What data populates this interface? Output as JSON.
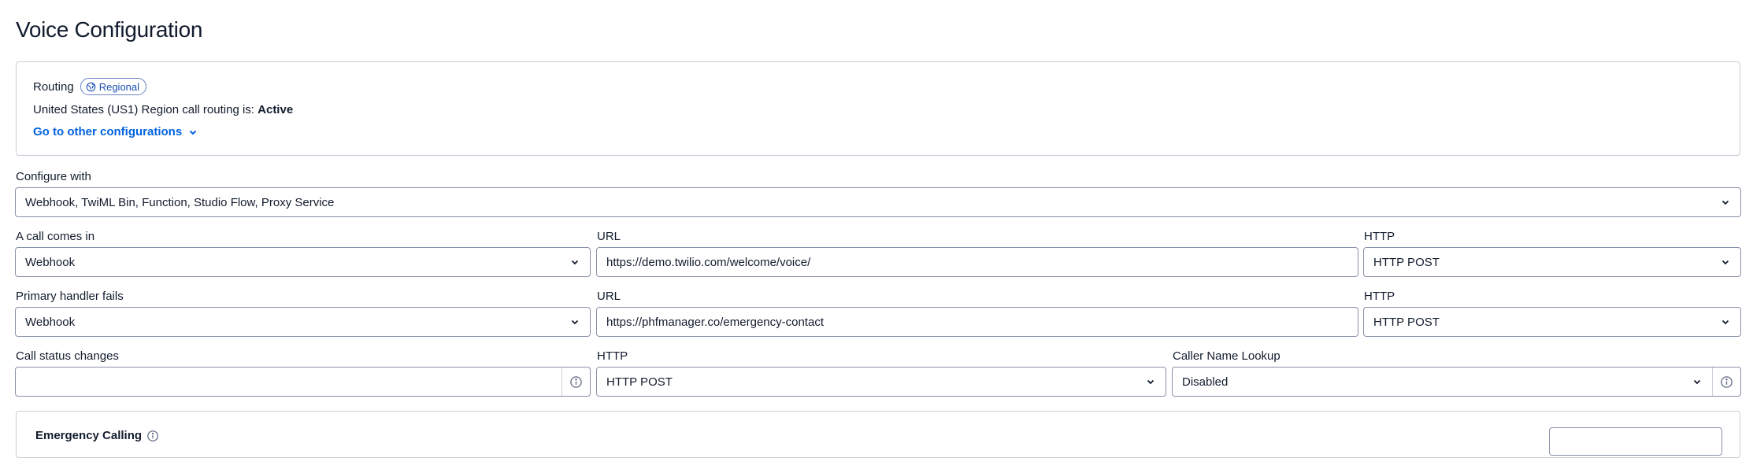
{
  "page": {
    "title": "Voice Configuration"
  },
  "routing": {
    "title": "Routing",
    "badge": "Regional",
    "status_prefix": "United States (US1) Region call routing is: ",
    "status_value": "Active",
    "link_label": "Go to other configurations"
  },
  "configure_with": {
    "label": "Configure with",
    "value": "Webhook, TwiML Bin, Function, Studio Flow, Proxy Service"
  },
  "call_comes_in": {
    "label": "A call comes in",
    "type_value": "Webhook",
    "url_label": "URL",
    "url_value": "https://demo.twilio.com/welcome/voice/",
    "http_label": "HTTP",
    "http_value": "HTTP POST"
  },
  "primary_handler_fails": {
    "label": "Primary handler fails",
    "type_value": "Webhook",
    "url_label": "URL",
    "url_value": "https://phfmanager.co/emergency-contact",
    "http_label": "HTTP",
    "http_value": "HTTP POST"
  },
  "call_status_changes": {
    "label": "Call status changes",
    "url_value": "",
    "http_label": "HTTP",
    "http_value": "HTTP POST",
    "cnam_label": "Caller Name Lookup",
    "cnam_value": "Disabled"
  },
  "emergency": {
    "title": "Emergency Calling"
  },
  "icons": {
    "badge": "globe-icon",
    "link": "chevron-down-icon",
    "select": "chevron-down-icon",
    "info": "info-icon"
  },
  "colors": {
    "text": "#121c2d",
    "link": "#0263e0",
    "border": "#8891aa",
    "badge": "#1d51b6"
  }
}
